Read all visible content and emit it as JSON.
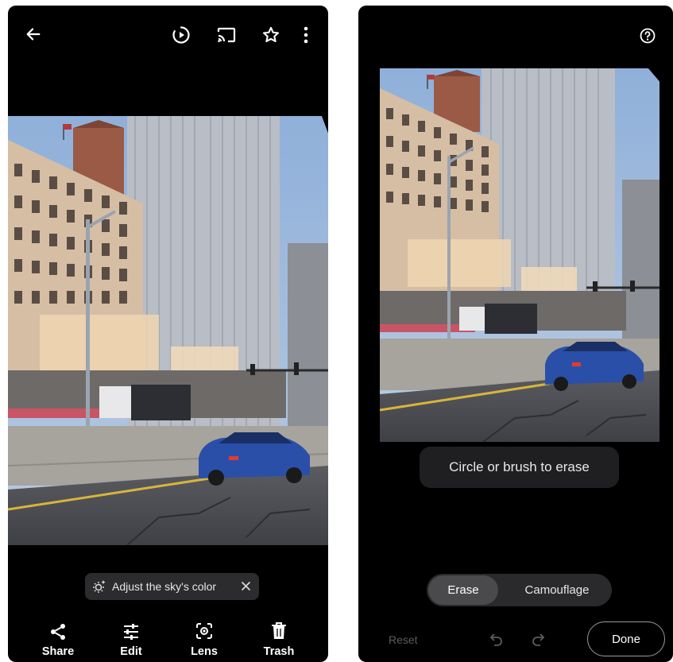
{
  "left_screen": {
    "top_bar": {
      "back_icon": "arrow-left-icon",
      "play_icon": "play-circle-icon",
      "cast_icon": "cast-icon",
      "favorite_icon": "star-outline-icon",
      "more_icon": "more-vertical-icon"
    },
    "suggestion_chip": {
      "icon": "sky-sparkle-icon",
      "label": "Adjust the sky's color",
      "close_icon": "close-icon"
    },
    "bottom_nav": [
      {
        "label": "Share",
        "icon": "share-icon"
      },
      {
        "label": "Edit",
        "icon": "sliders-icon"
      },
      {
        "label": "Lens",
        "icon": "lens-icon"
      },
      {
        "label": "Trash",
        "icon": "trash-icon"
      }
    ]
  },
  "right_screen": {
    "help_icon": "help-circle-icon",
    "hint_text": "Circle or brush to erase",
    "mode_toggle": {
      "selected": "Erase",
      "other": "Camouflage"
    },
    "reset_label": "Reset",
    "undo_icon": "undo-icon",
    "redo_icon": "redo-icon",
    "done_label": "Done"
  },
  "colors": {
    "background": "#000000",
    "chip_bg": "#2c2c2e",
    "sky": "#9fb9db",
    "car": "#2a4fa8"
  }
}
